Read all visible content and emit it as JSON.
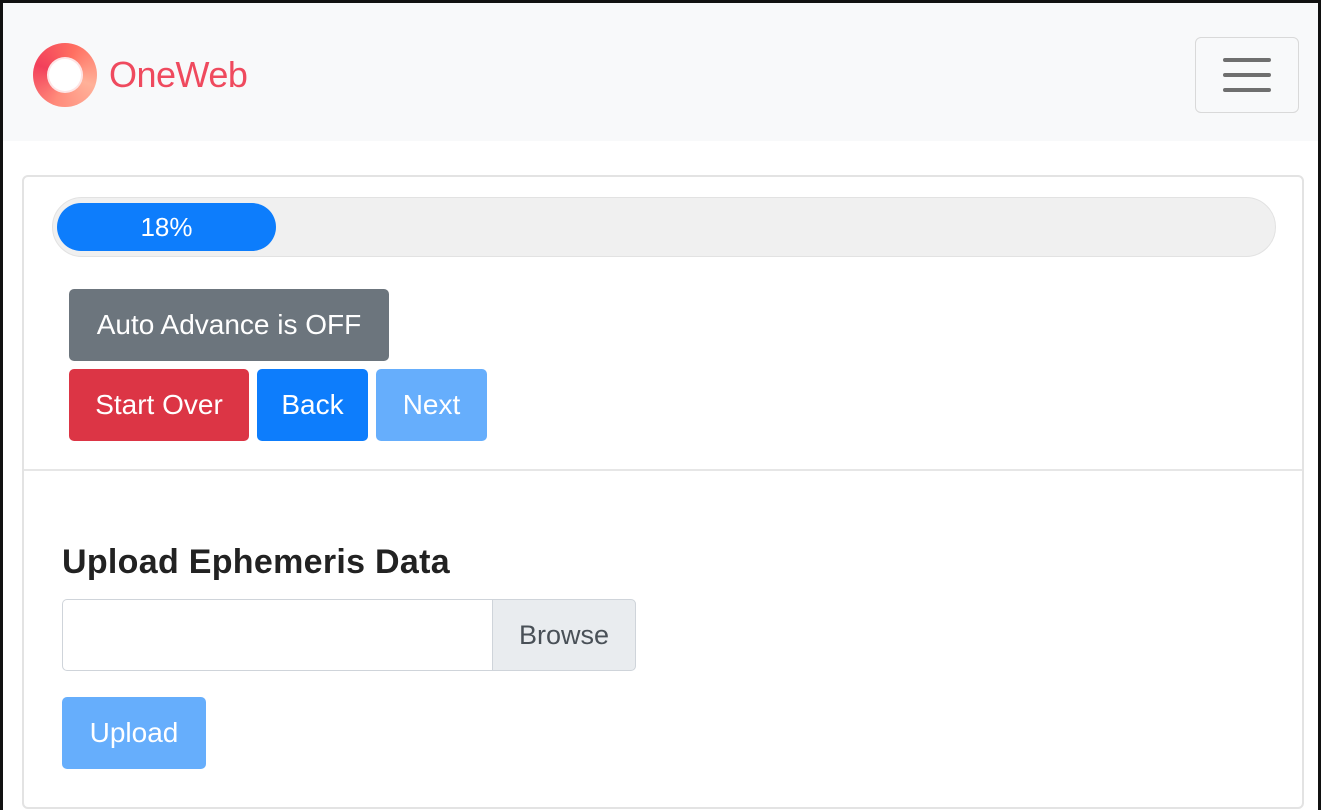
{
  "brand": {
    "name": "OneWeb",
    "color": "#ef4a5e"
  },
  "navbar": {
    "menu_icon": "hamburger-menu-icon"
  },
  "progress": {
    "value": 0.18,
    "label": "18%",
    "color": "#0d7dfc"
  },
  "controls": {
    "auto_advance_label": "Auto Advance is OFF",
    "start_over_label": "Start Over",
    "back_label": "Back",
    "next_label": "Next"
  },
  "upload": {
    "title": "Upload Ephemeris Data",
    "file_value": "",
    "browse_label": "Browse",
    "upload_label": "Upload"
  },
  "colors": {
    "primary": "#0d7dfc",
    "primary_disabled": "#66aefc",
    "danger": "#dc3545",
    "secondary": "#6c757d"
  }
}
